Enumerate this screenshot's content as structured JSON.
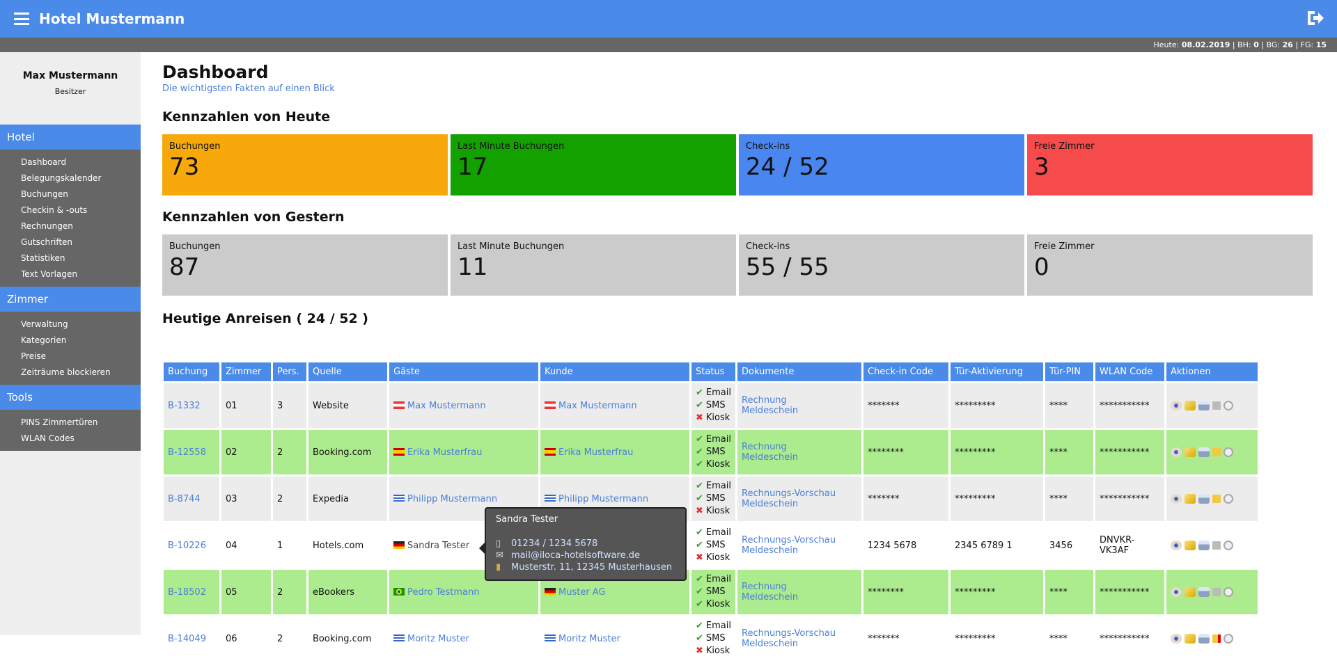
{
  "header": {
    "title": "Hotel Mustermann"
  },
  "statusbar": {
    "today_label": "Heute:",
    "today": "08.02.2019",
    "bh_label": "BH:",
    "bh": "0",
    "bg_label": "BG:",
    "bg": "26",
    "fg_label": "FG:",
    "fg": "15"
  },
  "user": {
    "name": "Max Mustermann",
    "role": "Besitzer"
  },
  "sidebar": {
    "sections": [
      {
        "label": "Hotel",
        "items": [
          "Dashboard",
          "Belegungskalender",
          "Buchungen",
          "Checkin & -outs",
          "Rechnungen",
          "Gutschriften",
          "Statistiken",
          "Text Vorlagen"
        ]
      },
      {
        "label": "Zimmer",
        "items": [
          "Verwaltung",
          "Kategorien",
          "Preise",
          "Zeiträume blockieren"
        ]
      },
      {
        "label": "Tools",
        "items": [
          "PINS Zimmertüren",
          "WLAN Codes"
        ]
      }
    ]
  },
  "page": {
    "title": "Dashboard",
    "subtitle": "Die wichtigsten Fakten auf einen Blick"
  },
  "today": {
    "title": "Kennzahlen von Heute",
    "cards": [
      {
        "label": "Buchungen",
        "value": "73",
        "color": "#f7a80b"
      },
      {
        "label": "Last Minute Buchungen",
        "value": "17",
        "color": "#13a100"
      },
      {
        "label": "Check-ins",
        "value": "24 / 52",
        "color": "#4a86f0"
      },
      {
        "label": "Freie Zimmer",
        "value": "3",
        "color": "#f64b4b"
      }
    ]
  },
  "yesterday": {
    "title": "Kennzahlen von Gestern",
    "cards": [
      {
        "label": "Buchungen",
        "value": "87"
      },
      {
        "label": "Last Minute Buchungen",
        "value": "11"
      },
      {
        "label": "Check-ins",
        "value": "55 / 55"
      },
      {
        "label": "Freie Zimmer",
        "value": "0"
      }
    ]
  },
  "arrivals": {
    "title": "Heutige Anreisen ( 24 / 52 )",
    "columns": [
      "Buchung",
      "Zimmer",
      "Pers.",
      "Quelle",
      "Gäste",
      "Kunde",
      "Status",
      "Dokumente",
      "Check-in Code",
      "Tür-Aktivierung",
      "Tür-PIN",
      "WLAN Code",
      "Aktionen"
    ],
    "rows": [
      {
        "bg": "w",
        "booking": "B-1332",
        "room": "01",
        "pers": "3",
        "source": "Website",
        "guest": "Max Mustermann",
        "guest_flag": "at",
        "customer": "Max Mustermann",
        "customer_flag": "at",
        "status": [
          [
            "Email",
            true
          ],
          [
            "SMS",
            true
          ],
          [
            "Kiosk",
            false
          ]
        ],
        "docs": [
          "Rechnung",
          "Meldeschein"
        ],
        "checkin": "*******",
        "door": "*********",
        "pin": "****",
        "wlan": "***********",
        "note": "gray"
      },
      {
        "bg": "g",
        "booking": "B-12558",
        "room": "02",
        "pers": "2",
        "source": "Booking.com",
        "guest": "Erika Musterfrau",
        "guest_flag": "es",
        "customer": "Erika Musterfrau",
        "customer_flag": "es",
        "status": [
          [
            "Email",
            true
          ],
          [
            "SMS",
            true
          ],
          [
            "Kiosk",
            true
          ]
        ],
        "docs": [
          "Rechnung",
          "Meldeschein"
        ],
        "checkin": "********",
        "door": "*********",
        "pin": "****",
        "wlan": "***********",
        "note": "yellow"
      },
      {
        "bg": "w",
        "booking": "B-8744",
        "room": "03",
        "pers": "2",
        "source": "Expedia",
        "guest": "Philipp Mustermann",
        "guest_flag": "gr",
        "customer": "Philipp Mustermann",
        "customer_flag": "gr",
        "status": [
          [
            "Email",
            true
          ],
          [
            "SMS",
            true
          ],
          [
            "Kiosk",
            false
          ]
        ],
        "docs": [
          "Rechnungs-Vorschau",
          "Meldeschein"
        ],
        "checkin": "*******",
        "door": "*********",
        "pin": "****",
        "wlan": "***********",
        "note": "yellow"
      },
      {
        "bg": "p",
        "booking": "B-10226",
        "room": "04",
        "pers": "1",
        "source": "Hotels.com",
        "guest": "Sandra Tester",
        "guest_flag": "de",
        "customer": "",
        "customer_flag": "",
        "status": [
          [
            "Email",
            true
          ],
          [
            "SMS",
            true
          ],
          [
            "Kiosk",
            false
          ]
        ],
        "docs": [
          "Rechnungs-Vorschau",
          "Meldeschein"
        ],
        "checkin": "1234 5678",
        "door": "2345 6789 1",
        "pin": "3456",
        "wlan": "DNVKR-VK3AF",
        "note": "gray"
      },
      {
        "bg": "g",
        "booking": "B-18502",
        "room": "05",
        "pers": "2",
        "source": "eBookers",
        "guest": "Pedro Testmann",
        "guest_flag": "br",
        "customer": "Muster AG",
        "customer_flag": "de",
        "status": [
          [
            "Email",
            true
          ],
          [
            "SMS",
            true
          ],
          [
            "Kiosk",
            true
          ]
        ],
        "docs": [
          "Rechnung",
          "Meldeschein"
        ],
        "checkin": "********",
        "door": "*********",
        "pin": "****",
        "wlan": "***********",
        "note": "gray"
      },
      {
        "bg": "p",
        "booking": "B-14049",
        "room": "06",
        "pers": "2",
        "source": "Booking.com",
        "guest": "Moritz Muster",
        "guest_flag": "gr",
        "customer": "Moritz Muster",
        "customer_flag": "gr",
        "status": [
          [
            "Email",
            true
          ],
          [
            "SMS",
            true
          ],
          [
            "Kiosk",
            false
          ]
        ],
        "docs": [
          "Rechnungs-Vorschau",
          "Meldeschein"
        ],
        "checkin": "*******",
        "door": "*********",
        "pin": "****",
        "wlan": "***********",
        "note": "red"
      }
    ]
  },
  "tooltip": {
    "name": "Sandra Tester",
    "phone": "01234 / 1234 5678",
    "email": "mail@iloca-hotelsoftware.de",
    "address": "Musterstr. 11, 12345 Musterhausen"
  }
}
